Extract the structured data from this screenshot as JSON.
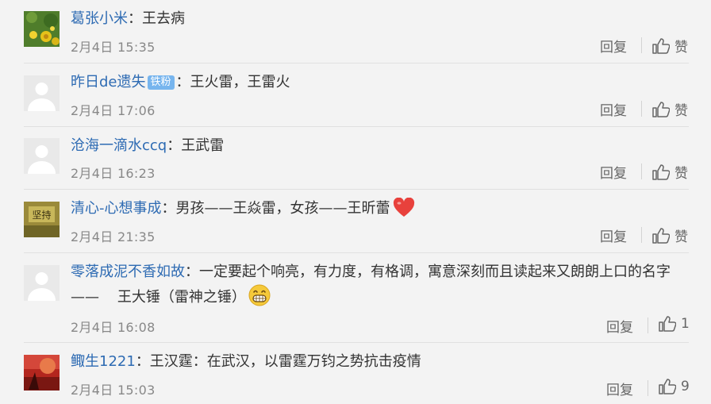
{
  "reply_label": "回复",
  "comments": [
    {
      "user": "葛张小米",
      "text": "：王去病",
      "date": "2月4日 15:35",
      "like": "赞"
    },
    {
      "user": "昨日de遗失",
      "badge": "铁粉",
      "text": "：王火雷，王雷火",
      "date": "2月4日 17:06",
      "like": "赞"
    },
    {
      "user": "沧海一滴水ccq",
      "text": "：王武雷",
      "date": "2月4日 16:23",
      "like": "赞"
    },
    {
      "user": "清心-心想事成",
      "text": "：男孩——王焱雷，女孩——王昕蕾",
      "date": "2月4日 21:35",
      "like": "赞",
      "avatar_text": "坚持"
    },
    {
      "user": "零落成泥不香如故",
      "text": "：一定要起个响亮，有力度，有格调，寓意深刻而且读起来又朗朗上口的名字",
      "text2": "——    王大锤（雷神之锤）",
      "date": "2月4日 16:08",
      "like": "1"
    },
    {
      "user": "鲰生1221",
      "text": "：王汉霆：在武汉，以雷霆万钧之势抗击疫情",
      "date": "2月4日 15:03",
      "like": "9"
    }
  ],
  "colors": {
    "link": "#2e6bb3",
    "badge": "#77b5ee",
    "heart": "#e8413c"
  },
  "icons": [
    "thumbs-up-icon",
    "heart-emoji",
    "grin-emoji"
  ]
}
